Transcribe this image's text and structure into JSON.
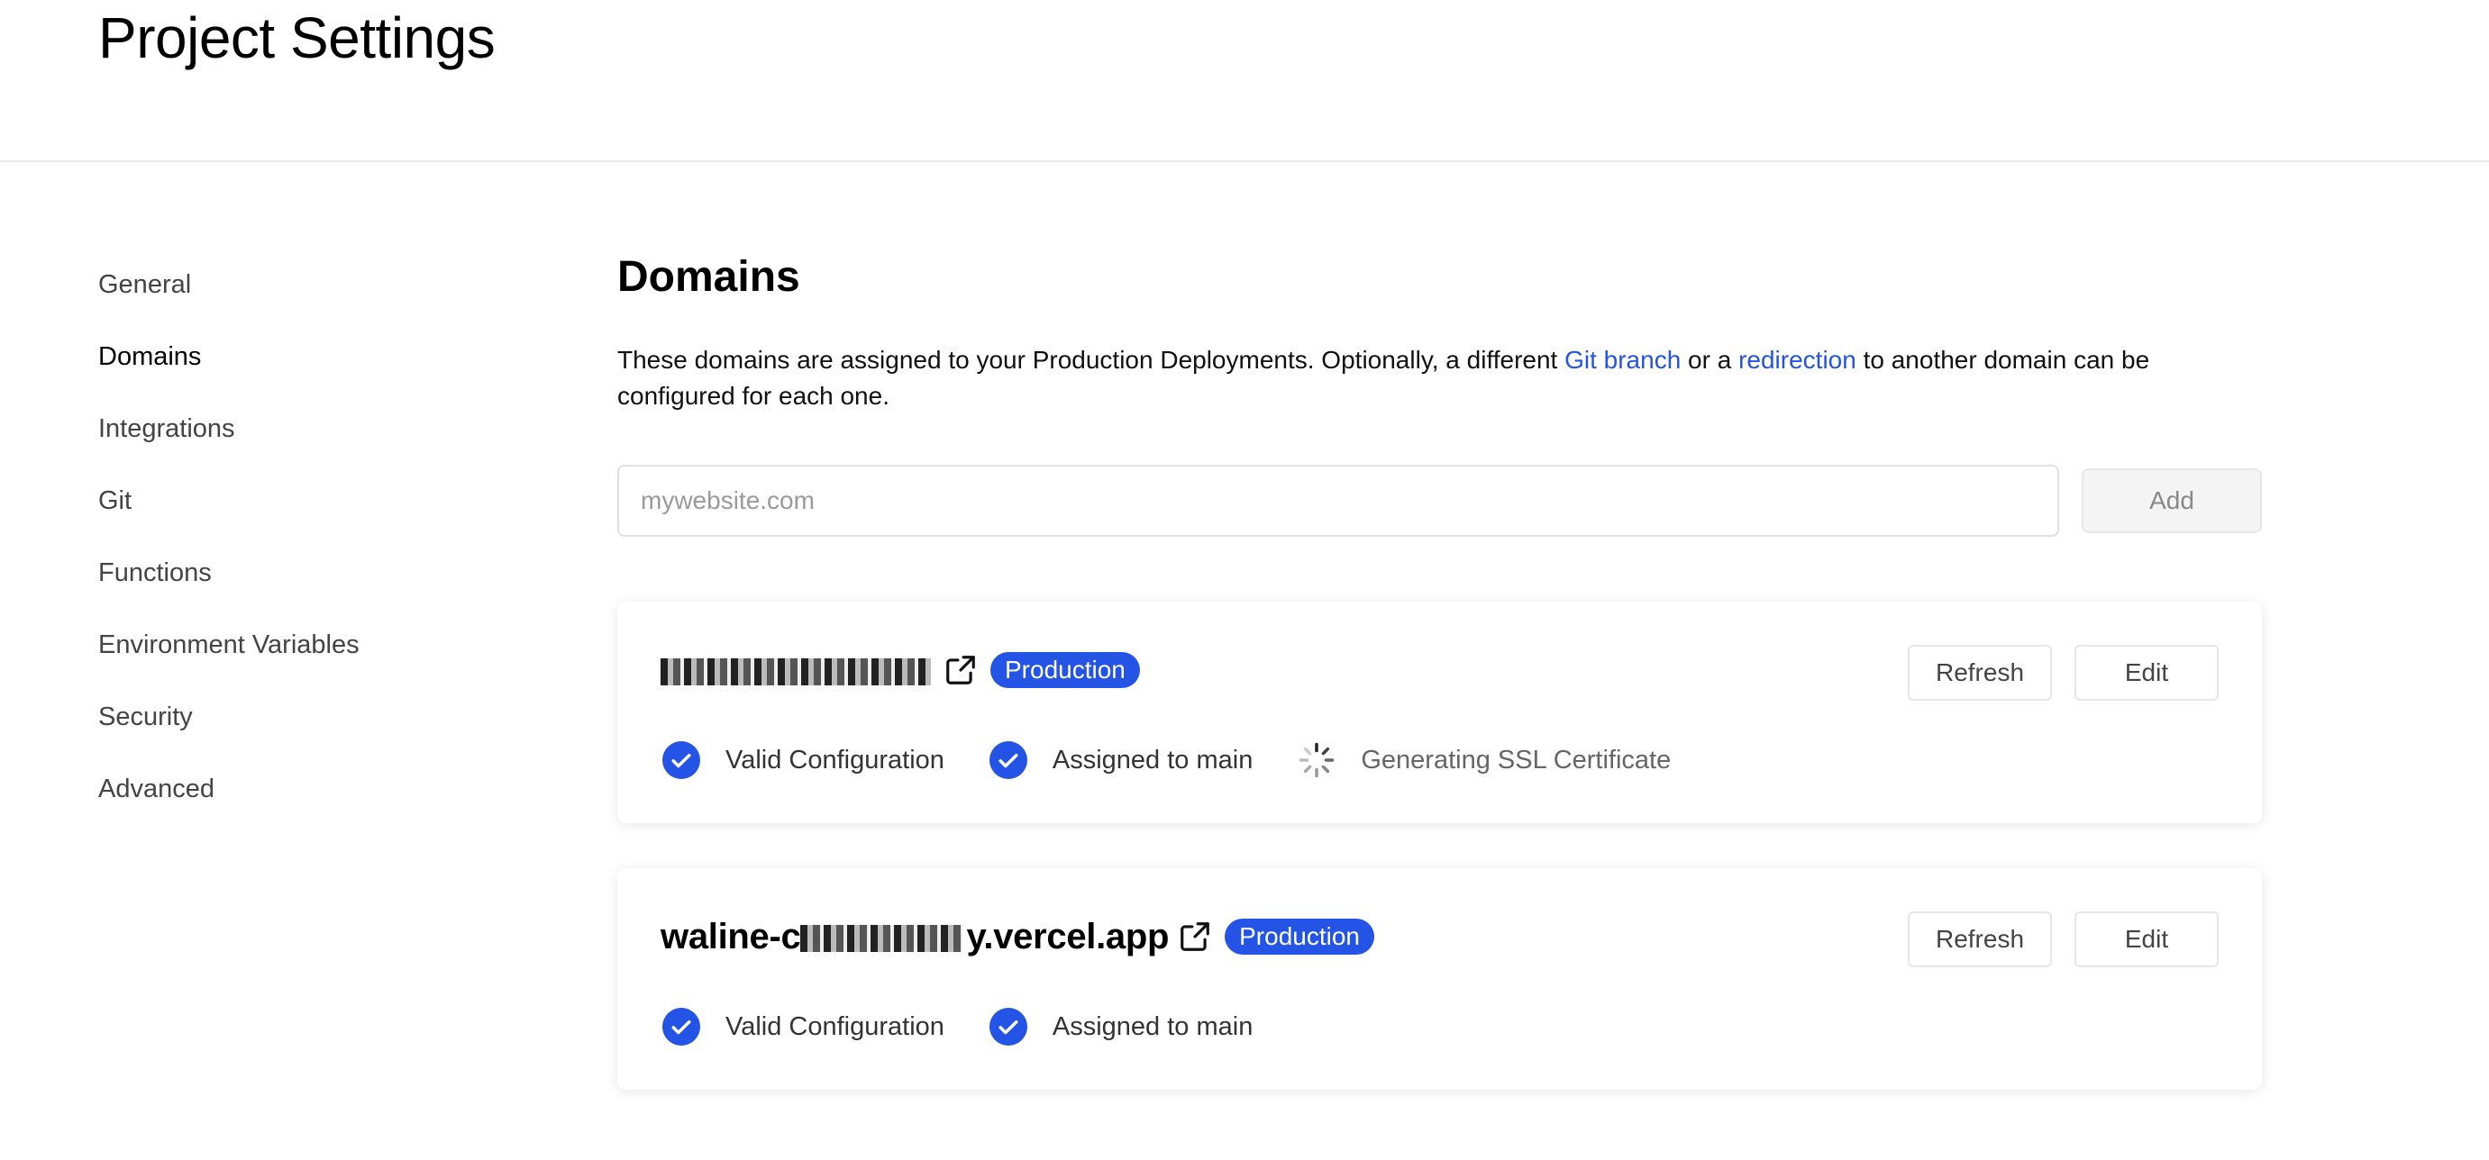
{
  "header": {
    "title": "Project Settings"
  },
  "sidebar": {
    "items": [
      {
        "label": "General"
      },
      {
        "label": "Domains",
        "active": true
      },
      {
        "label": "Integrations"
      },
      {
        "label": "Git"
      },
      {
        "label": "Functions"
      },
      {
        "label": "Environment Variables"
      },
      {
        "label": "Security"
      },
      {
        "label": "Advanced"
      }
    ]
  },
  "main": {
    "title": "Domains",
    "description": {
      "part1": "These domains are assigned to your Production Deployments. Optionally, a different ",
      "link1": "Git branch",
      "part2": " or a ",
      "link2": "redirection",
      "part3": " to another domain can be configured for each one."
    },
    "input": {
      "placeholder": "mywebsite.com",
      "value": ""
    },
    "add_label": "Add",
    "domains": [
      {
        "name_visible_suffix": "",
        "badge": "Production",
        "refresh_label": "Refresh",
        "edit_label": "Edit",
        "statuses": [
          {
            "label": "Valid Configuration",
            "state": "ok"
          },
          {
            "label": "Assigned to main",
            "state": "ok"
          },
          {
            "label": "Generating SSL Certificate",
            "state": "pending"
          }
        ]
      },
      {
        "name_prefix": "waline-c",
        "name_suffix": "y.vercel.app",
        "badge": "Production",
        "refresh_label": "Refresh",
        "edit_label": "Edit",
        "statuses": [
          {
            "label": "Valid Configuration",
            "state": "ok"
          },
          {
            "label": "Assigned to main",
            "state": "ok"
          }
        ]
      }
    ]
  },
  "colors": {
    "accent": "#2454e6",
    "border": "#e6e6e6",
    "text": "#111111",
    "muted": "#444444"
  },
  "icons": {
    "external_link": "external-link-icon",
    "check": "check-circle-icon",
    "spinner": "spinner-icon"
  }
}
